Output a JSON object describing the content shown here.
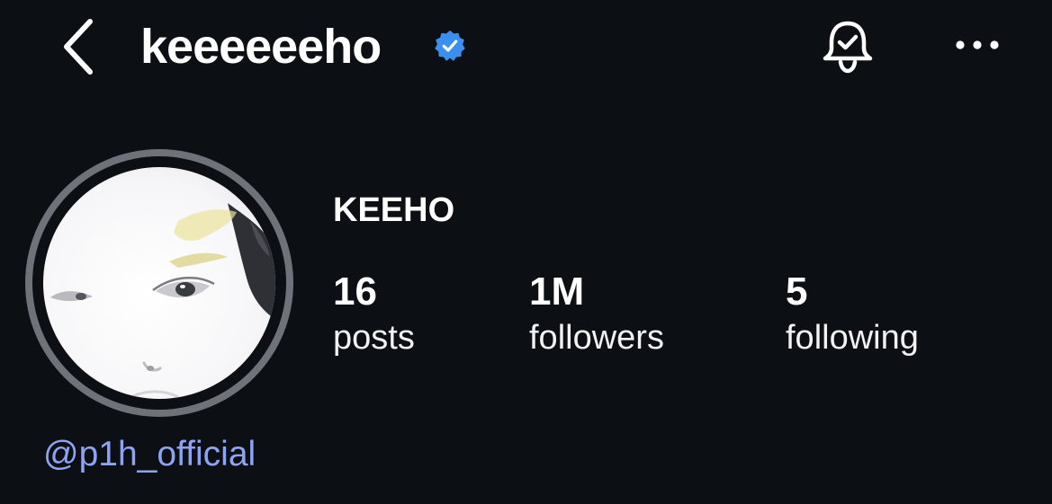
{
  "header": {
    "username": "keeeeeeho",
    "back_icon": "chevron-left-icon",
    "verified_icon": "verified-badge-icon",
    "notify_icon": "bell-check-icon",
    "more_icon": "more-horizontal-icon"
  },
  "profile": {
    "display_name": "KEEHO",
    "stats": {
      "posts": {
        "value": "16",
        "label": "posts"
      },
      "followers": {
        "value": "1M",
        "label": "followers"
      },
      "following": {
        "value": "5",
        "label": "following"
      }
    },
    "mention": "@p1h_official"
  },
  "colors": {
    "background": "#0c0f14",
    "text": "#ffffff",
    "verified_blue": "#3b8ff0",
    "mention_link": "#8fa4f0",
    "avatar_ring": "#6f7278"
  }
}
